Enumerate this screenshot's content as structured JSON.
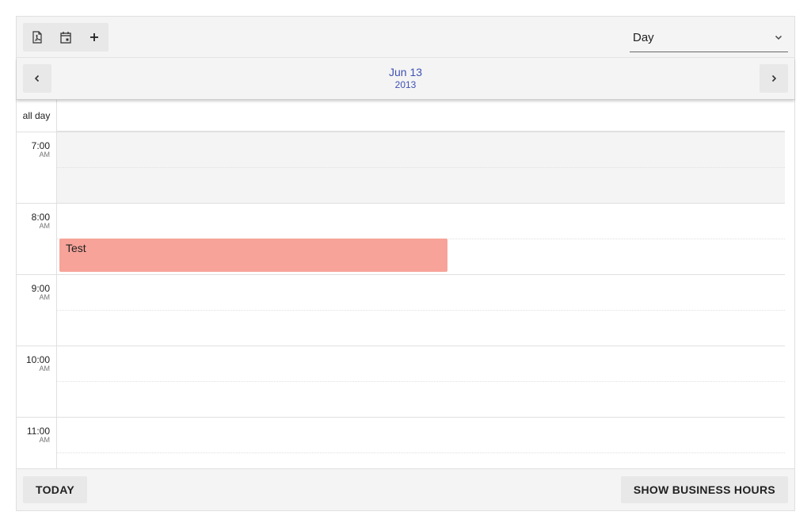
{
  "toolbar": {
    "tools": [
      {
        "name": "pdf-export-button",
        "icon": "file-pdf-icon"
      },
      {
        "name": "calendar-button",
        "icon": "calendar-icon"
      },
      {
        "name": "add-event-button",
        "icon": "plus-icon"
      }
    ],
    "view": {
      "selected": "Day"
    }
  },
  "datenav": {
    "month_day": "Jun 13",
    "year": "2013"
  },
  "grid": {
    "allday_label": "all day",
    "hours": [
      {
        "time": "7:00",
        "ampm": "AM"
      },
      {
        "time": "8:00",
        "ampm": "AM"
      },
      {
        "time": "9:00",
        "ampm": "AM"
      },
      {
        "time": "10:00",
        "ampm": "AM"
      },
      {
        "time": "11:00",
        "ampm": "AM"
      }
    ]
  },
  "event": {
    "title": "Test",
    "color": "#f7a399"
  },
  "footer": {
    "today_label": "TODAY",
    "business_hours_label": "SHOW BUSINESS HOURS"
  },
  "colors": {
    "accent": "#3f51b5",
    "toolbar_bg": "#f4f4f4",
    "off_hours_bg": "#f4f4f4"
  }
}
